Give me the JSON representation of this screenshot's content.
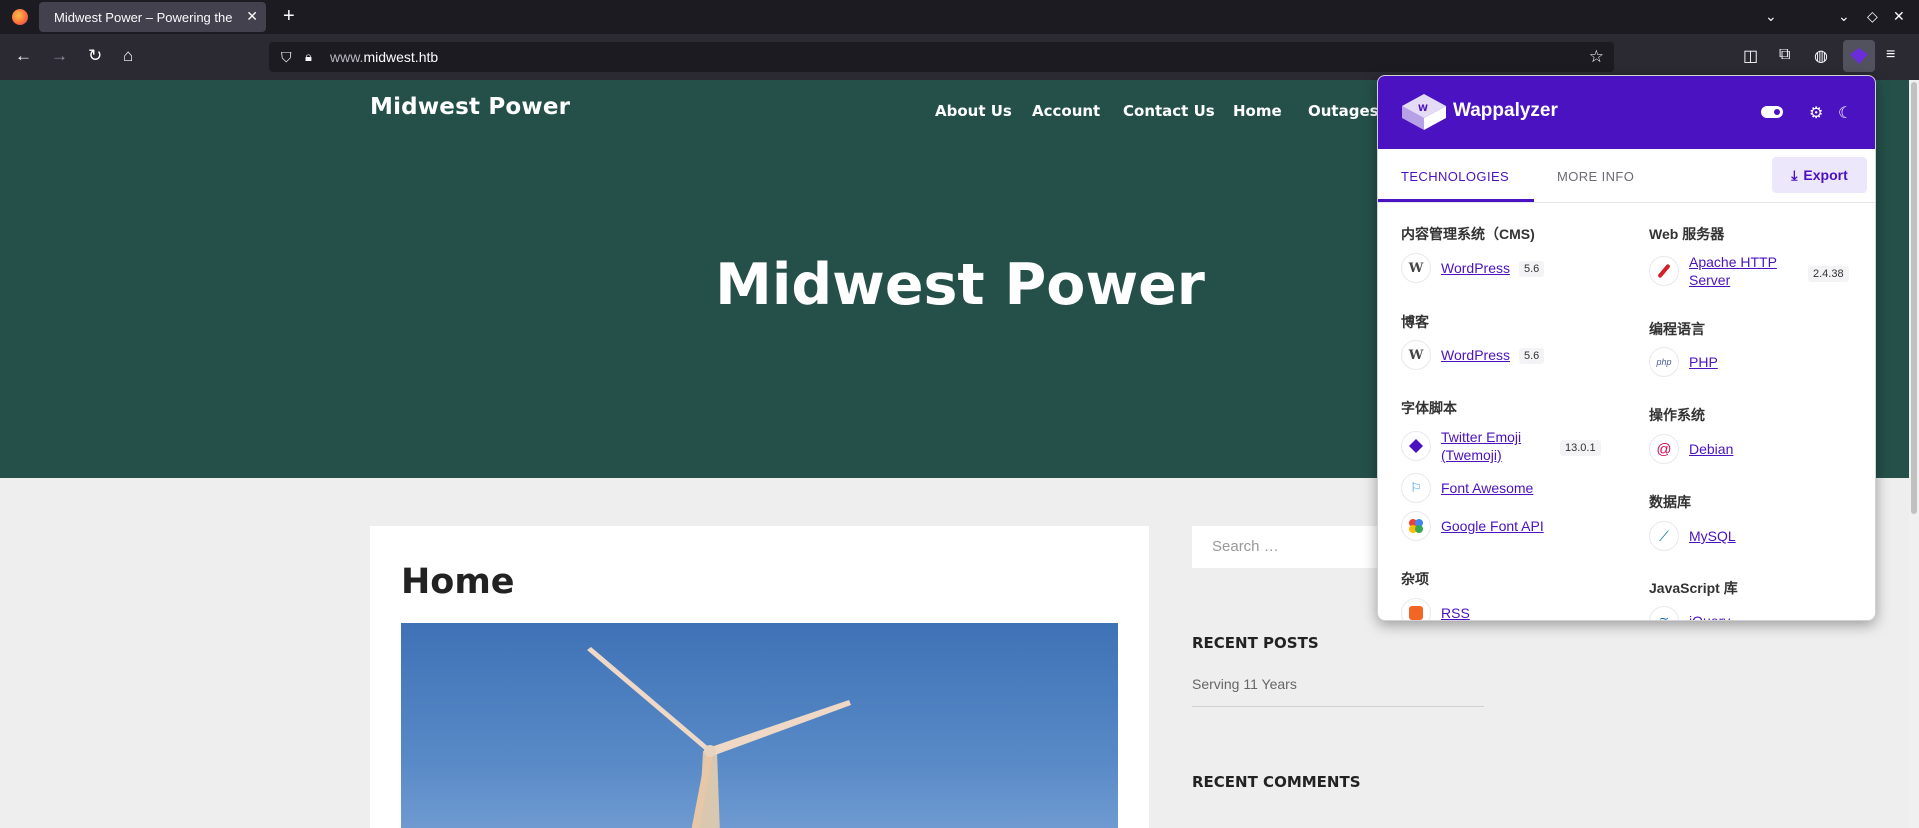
{
  "browser": {
    "tab_title": "Midwest Power – Powering the",
    "url": "www.midwest.htb",
    "url_prefix": "www.",
    "url_domain": "midwest.htb"
  },
  "site": {
    "title": "Midwest Power",
    "menu": [
      "About Us",
      "Account",
      "Contact Us",
      "Home",
      "Outages"
    ],
    "hero_title": "Midwest Power",
    "page_title": "Home",
    "search_placeholder": "Search …",
    "recent_posts_title": "RECENT POSTS",
    "recent_post_1": "Serving 11 Years",
    "recent_comments_title": "RECENT COMMENTS"
  },
  "wappalyzer": {
    "name": "Wappalyzer",
    "tabs": {
      "technologies": "TECHNOLOGIES",
      "more_info": "MORE INFO"
    },
    "export_label": "Export",
    "left": [
      {
        "category": "内容管理系统（CMS)",
        "items": [
          {
            "name": "WordPress",
            "version": "5.6",
            "icon": "wordpress-icon"
          }
        ]
      },
      {
        "category": "博客",
        "items": [
          {
            "name": "WordPress",
            "version": "5.6",
            "icon": "wordpress-icon"
          }
        ]
      },
      {
        "category": "字体脚本",
        "items": [
          {
            "name": "Twitter Emoji (Twemoji)",
            "name_line1": "Twitter Emoji",
            "name_line2": "(Twemoji)",
            "version": "13.0.1",
            "icon": "twemoji-icon"
          },
          {
            "name": "Font Awesome",
            "version": "",
            "icon": "font-awesome-icon"
          },
          {
            "name": "Google Font API",
            "version": "",
            "icon": "google-font-icon"
          }
        ]
      },
      {
        "category": "杂项",
        "items": [
          {
            "name": "RSS",
            "version": "",
            "icon": "rss-icon"
          }
        ]
      }
    ],
    "right": [
      {
        "category": "Web 服务器",
        "items": [
          {
            "name": "Apache HTTP Server",
            "name_line1": "Apache HTTP",
            "name_line2": "Server",
            "version": "2.4.38",
            "icon": "apache-icon"
          }
        ]
      },
      {
        "category": "编程语言",
        "items": [
          {
            "name": "PHP",
            "version": "",
            "icon": "php-icon"
          }
        ]
      },
      {
        "category": "操作系统",
        "items": [
          {
            "name": "Debian",
            "version": "",
            "icon": "debian-icon"
          }
        ]
      },
      {
        "category": "数据库",
        "items": [
          {
            "name": "MySQL",
            "version": "",
            "icon": "mysql-icon"
          }
        ]
      },
      {
        "category": "JavaScript 库",
        "items": [
          {
            "name": "jQuery",
            "version": "",
            "icon": "jquery-icon"
          }
        ]
      }
    ]
  },
  "colors": {
    "hero_bg": "#25504a",
    "wappalyzer_purple": "#4a12c0",
    "page_bg": "#eeeeee"
  }
}
